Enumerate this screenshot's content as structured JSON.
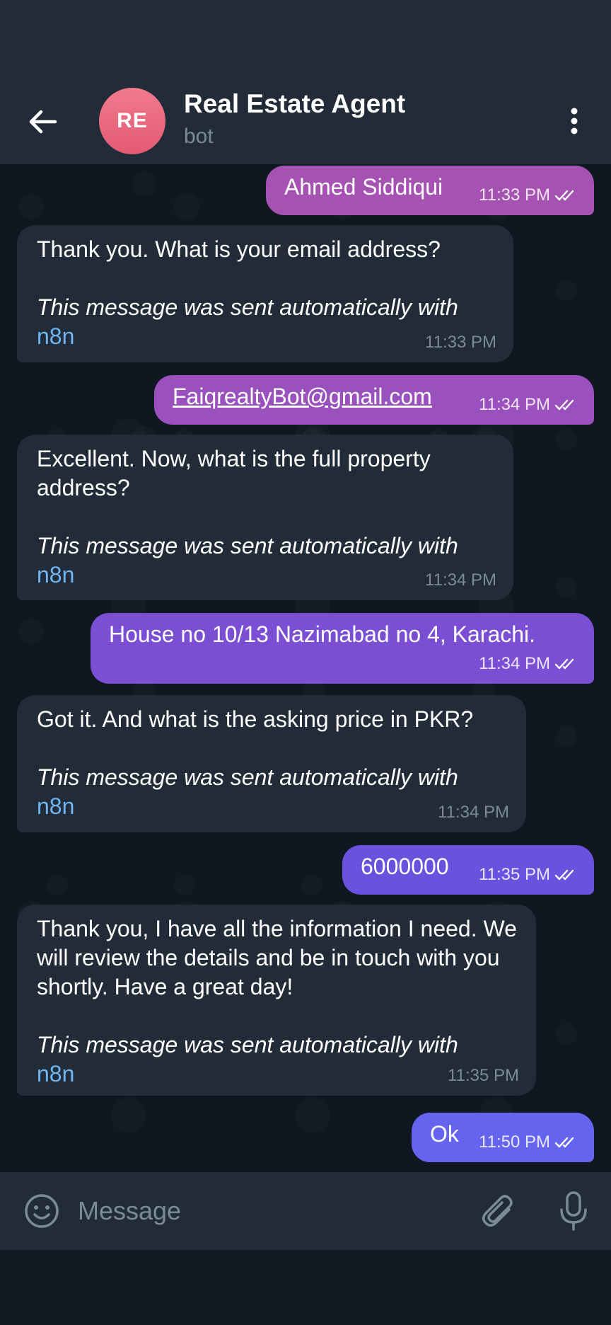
{
  "header": {
    "avatar_initials": "RE",
    "title": "Real Estate Agent",
    "subtitle": "bot",
    "back_icon": "arrow-left-icon",
    "menu_icon": "more-vertical-icon"
  },
  "messages": [
    {
      "direction": "out",
      "text": "Ahmed Siddiqui",
      "time": "11:33 PM",
      "status": "read"
    },
    {
      "direction": "in",
      "text": "Thank you. What is your email address?",
      "footer": "This message was sent automatically with",
      "link": "n8n",
      "time": "11:33 PM"
    },
    {
      "direction": "out",
      "text": "FaiqrealtyBot@gmail.com",
      "time": "11:34 PM",
      "status": "read"
    },
    {
      "direction": "in",
      "text": "Excellent. Now, what is the full property address?",
      "footer": "This message was sent automatically with",
      "link": "n8n",
      "time": "11:34 PM"
    },
    {
      "direction": "out",
      "text": "House no 10/13 Nazimabad no 4, Karachi.",
      "time": "11:34 PM",
      "status": "read"
    },
    {
      "direction": "in",
      "text": "Got it. And what is the asking price in PKR?",
      "footer": "This message was sent automatically with",
      "link": "n8n",
      "time": "11:34 PM"
    },
    {
      "direction": "out",
      "text": "6000000",
      "time": "11:35 PM",
      "status": "read"
    },
    {
      "direction": "in",
      "text": "Thank you, I have all the information I need. We will review the details and be in touch with you shortly. Have a great day!",
      "footer": "This message was sent automatically with",
      "link": "n8n",
      "time": "11:35 PM"
    },
    {
      "direction": "out",
      "text": "Ok",
      "time": "11:50 PM",
      "status": "read"
    }
  ],
  "composer": {
    "placeholder": "Message",
    "emoji_icon": "emoji-icon",
    "attach_icon": "paperclip-icon",
    "mic_icon": "microphone-icon"
  },
  "colors": {
    "header_bg": "#222c38",
    "incoming_bubble": "#222c38",
    "outgoing_gradient_top": "#a852b4",
    "outgoing_gradient_bottom": "#6a6af0",
    "link": "#6fb6f3",
    "avatar": "#ea6b80"
  }
}
